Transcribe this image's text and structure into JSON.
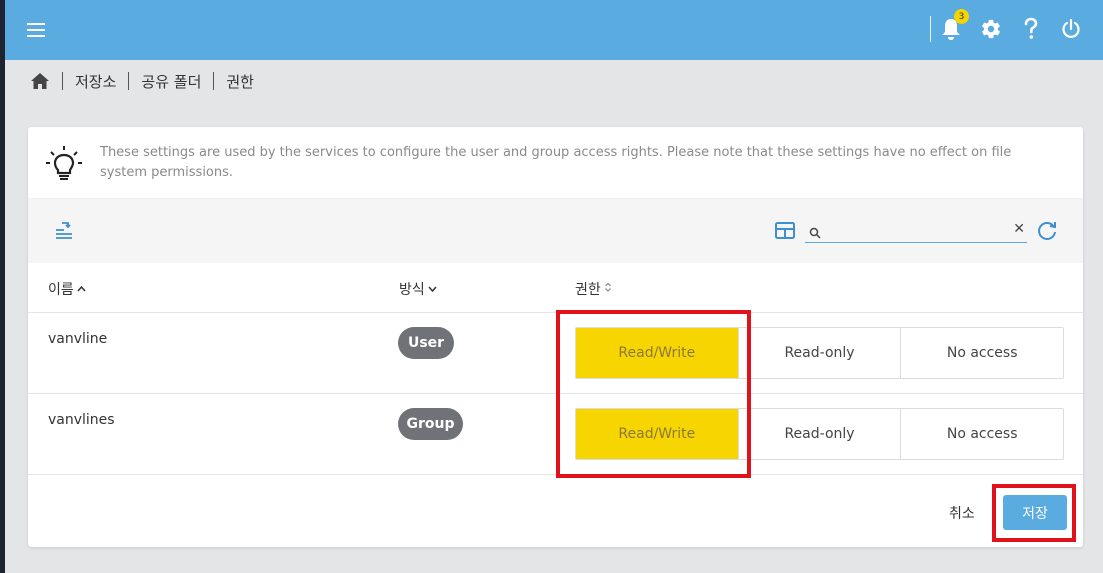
{
  "header": {
    "notification_count": "3",
    "icons": [
      "menu-icon",
      "bell-icon",
      "gear-icon",
      "help-icon",
      "power-icon"
    ]
  },
  "breadcrumb": {
    "items": [
      "저장소",
      "공유 폴더",
      "권한"
    ]
  },
  "info": {
    "text": "These settings are used by the services to configure the user and group access rights. Please note that these settings have no effect on file system permissions."
  },
  "search": {
    "value": "",
    "placeholder": ""
  },
  "table": {
    "columns": {
      "name": "이름",
      "type": "방식",
      "permission": "권한"
    },
    "permission_options": [
      "Read/Write",
      "Read-only",
      "No access"
    ],
    "rows": [
      {
        "name": "vanvline",
        "type": "User",
        "selected": "Read/Write"
      },
      {
        "name": "vanvlines",
        "type": "Group",
        "selected": "Read/Write"
      }
    ]
  },
  "footer": {
    "cancel_label": "취소",
    "save_label": "저장"
  },
  "colors": {
    "topbar": "#5aabe0",
    "active_option": "#f7d500",
    "chip": "#6f7377",
    "highlight": "#e0121c"
  }
}
